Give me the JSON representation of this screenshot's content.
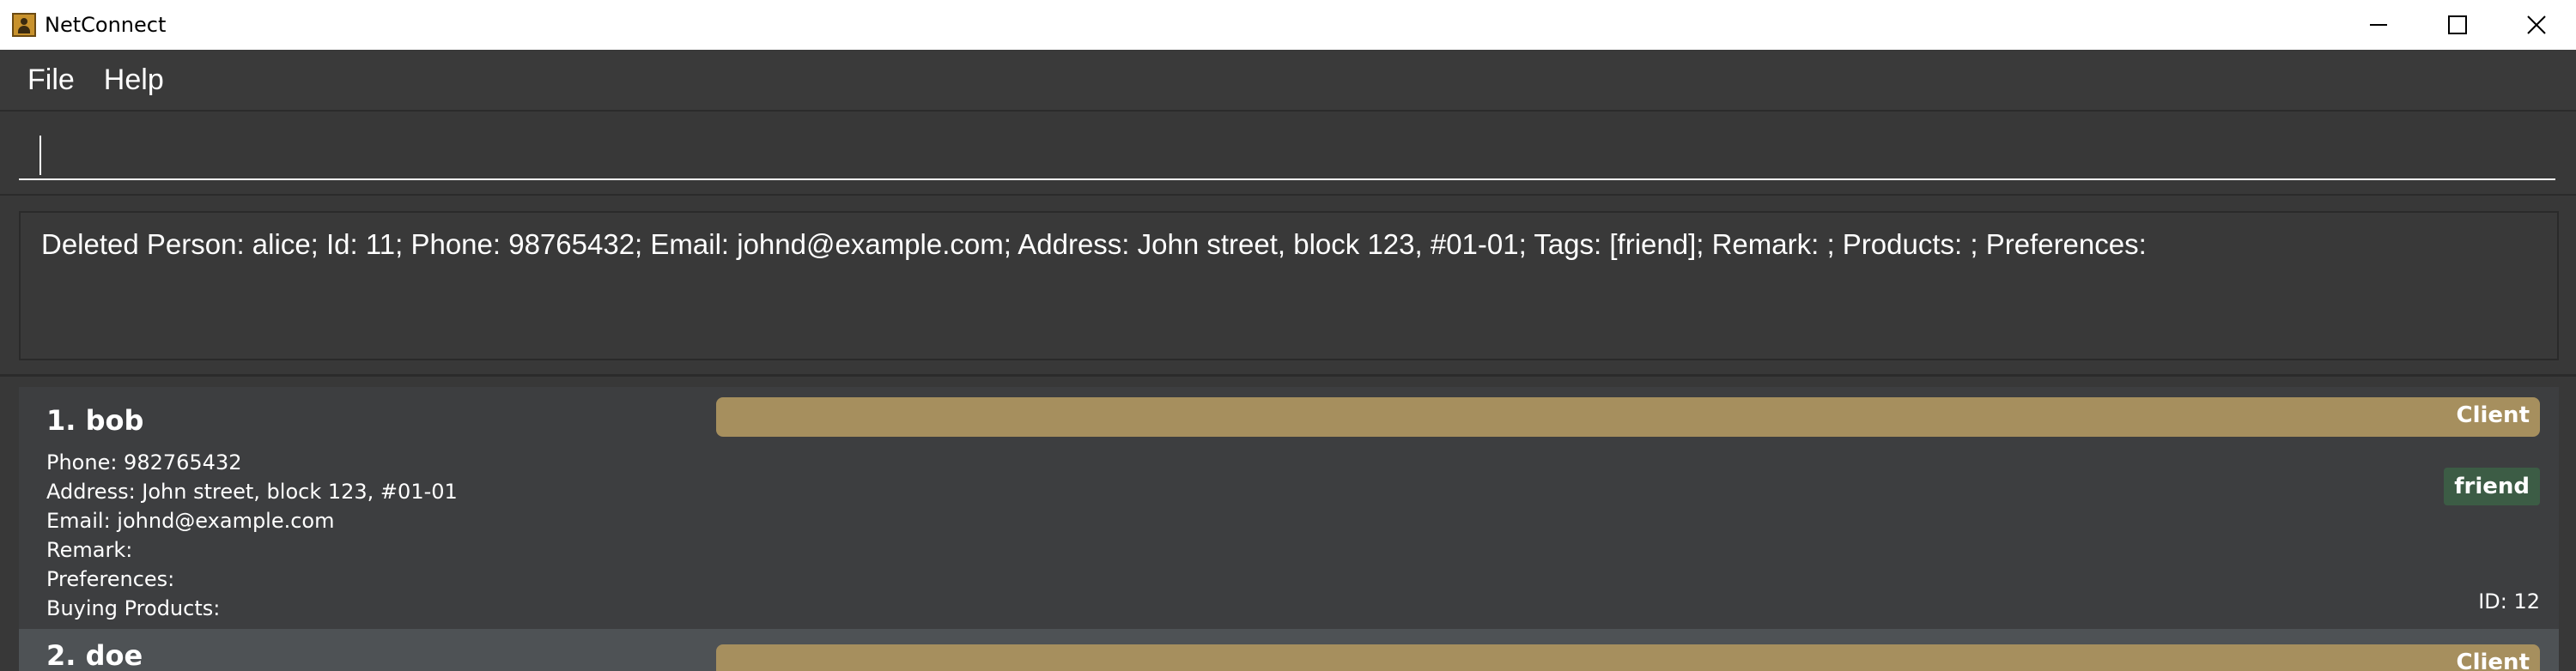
{
  "window": {
    "title": "NetConnect"
  },
  "menu": {
    "items": [
      "File",
      "Help"
    ]
  },
  "command": {
    "value": ""
  },
  "result": {
    "text": "Deleted Person: alice; Id: 11; Phone: 98765432; Email: johnd@example.com; Address: John street, block 123, #01-01; Tags: [friend]; Remark: ; Products: ; Preferences:"
  },
  "persons": [
    {
      "name": "1.  bob",
      "role": "Client",
      "phone": "Phone: 982765432",
      "address": "Address: John street, block 123, #01-01",
      "email": "Email: johnd@example.com",
      "remark": "Remark:",
      "preferences": "Preferences:",
      "products": "Buying Products:",
      "tag": "friend",
      "id": "ID: 12"
    },
    {
      "name": "2.  doe",
      "role": "Client"
    }
  ],
  "colors": {
    "background": "#383838",
    "role_bar": "#a68f5e",
    "tag": "#3c5c45",
    "card_selected": "#4e5255"
  }
}
